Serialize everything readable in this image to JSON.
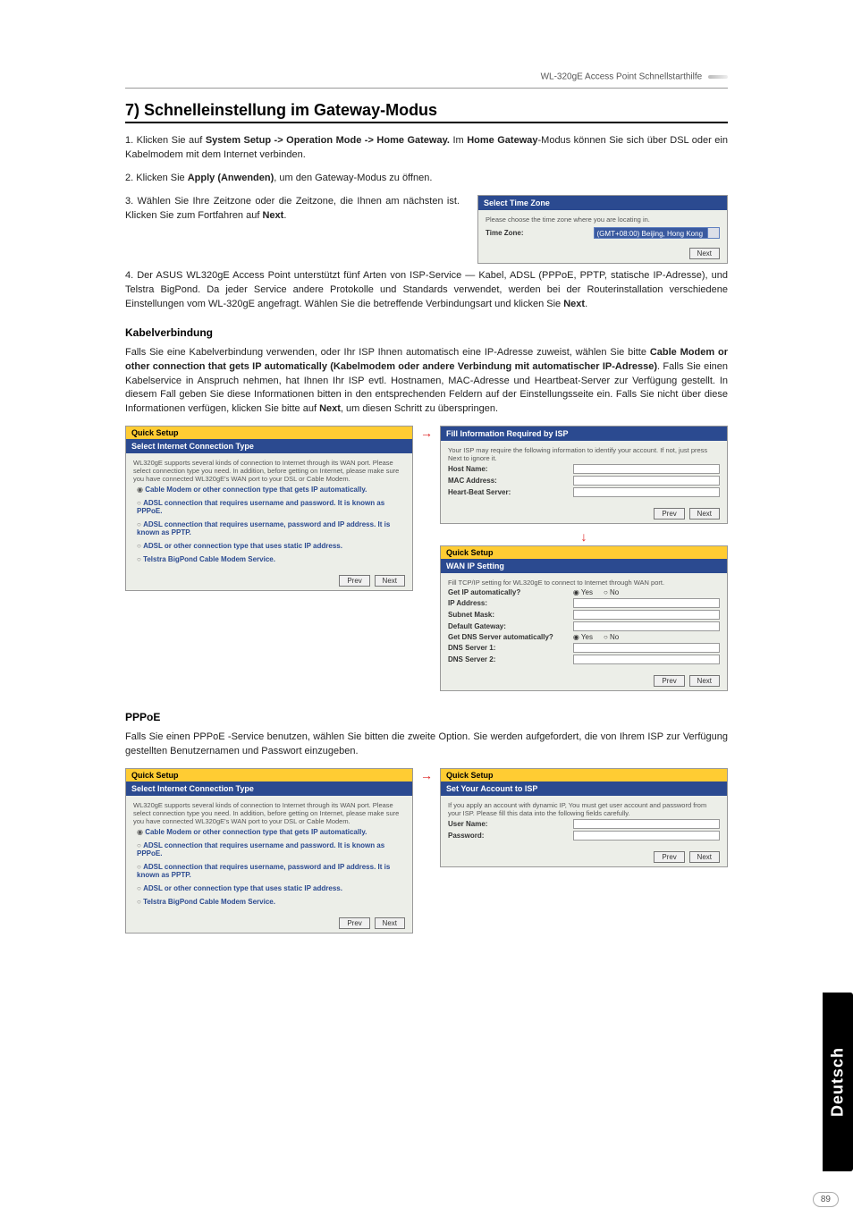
{
  "header": {
    "product": "WL-320gE Access Point Schnellstarthilfe"
  },
  "section": {
    "title": "7) Schnelleinstellung im Gateway-Modus",
    "step1_pre": "1. Klicken Sie auf ",
    "step1_bold1": "System Setup -> Operation Mode -> Home Gateway.",
    "step1_mid": " Im ",
    "step1_bold2": "Home Gateway",
    "step1_post": "-Modus können Sie sich über DSL oder ein Kabelmodem mit dem Internet verbinden.",
    "step2_pre": "2. Klicken Sie ",
    "step2_bold": "Apply (Anwenden)",
    "step2_post": ", um den Gateway-Modus zu öffnen.",
    "step3_pre": "3. Wählen Sie Ihre Zeitzone oder die Zeitzone, die Ihnen am nächsten ist. Klicken Sie zum Fortfahren auf ",
    "step3_bold": "Next",
    "step3_post": ".",
    "step4_pre": "4. Der ASUS WL320gE Access Point unterstützt fünf Arten von ISP-Service — Kabel, ADSL (PPPoE, PPTP, statische IP-Adresse), und Telstra BigPond. Da jeder Service andere Protokolle und Standards verwendet, werden bei der Routerinstallation verschiedene Einstellungen vom WL-320gE angefragt. Wählen Sie die betreffende Verbindungsart und klicken Sie ",
    "step4_bold": "Next",
    "step4_post": "."
  },
  "tz_panel": {
    "hdr": "Select Time Zone",
    "note": "Please choose the time zone where you are locating in.",
    "label": "Time Zone:",
    "value": "(GMT+08:00) Beijing, Hong Kong",
    "btn_next": "Next"
  },
  "kabel": {
    "title": "Kabelverbindung",
    "para_pre": "Falls Sie eine Kabelverbindung verwenden, oder Ihr ISP Ihnen automatisch eine IP-Adresse zuweist, wählen Sie bitte ",
    "para_bold": "Cable Modem or other connection that gets IP automatically (Kabelmodem oder andere Verbindung mit automatischer IP-Adresse)",
    "para_mid": ". Falls Sie einen Kabelservice in Anspruch nehmen, hat Ihnen Ihr ISP evtl. Hostnamen, MAC-Adresse und Heartbeat-Server zur Verfügung gestellt. In diesem Fall geben Sie diese Informationen bitten in den entsprechenden Feldern auf der Einstellungsseite ein. Falls Sie nicht über diese Informationen verfügen, klicken Sie bitte auf ",
    "para_bold2": "Next",
    "para_post": ", um diesen Schritt zu überspringen."
  },
  "quick_left": {
    "yellow": "Quick Setup",
    "hdr": "Select Internet Connection Type",
    "desc": "WL320gE supports several kinds of connection to Internet through its WAN port. Please select connection type you need. In addition, before getting on Internet, please make sure you have connected WL320gE's WAN port to your DSL or Cable Modem.",
    "opt1": "Cable Modem or other connection type that gets IP automatically.",
    "opt2": "ADSL connection that requires username and password. It is known as PPPoE.",
    "opt3": "ADSL connection that requires username, password and IP address. It is known as PPTP.",
    "opt4": "ADSL or other connection type that uses static IP address.",
    "opt5": "Telstra BigPond Cable Modem Service.",
    "btn_prev": "Prev",
    "btn_next": "Next"
  },
  "quick_r1": {
    "hdr": "Fill Information Required by ISP",
    "note": "Your ISP may require the following information to identify your account. If not, just press Next to ignore it.",
    "host": "Host Name:",
    "mac": "MAC Address:",
    "hb": "Heart-Beat Server:",
    "btn_prev": "Prev",
    "btn_next": "Next"
  },
  "quick_r2": {
    "yellow": "Quick Setup",
    "hdr": "WAN IP Setting",
    "note": "Fill TCP/IP setting for WL320gE to connect to Internet through WAN port.",
    "getip": "Get IP automatically?",
    "ip": "IP Address:",
    "mask": "Subnet Mask:",
    "gw": "Default Gateway:",
    "getdns": "Get DNS Server automatically?",
    "dns1": "DNS Server 1:",
    "dns2": "DNS Server 2:",
    "yes": "Yes",
    "no": "No",
    "btn_prev": "Prev",
    "btn_next": "Next"
  },
  "pppoe": {
    "title": "PPPoE",
    "para": "Falls Sie einen PPPoE -Service benutzen, wählen Sie bitten die zweite Option. Sie werden aufgefordert, die von Ihrem ISP zur Verfügung gestellten Benutzernamen und Passwort einzugeben."
  },
  "pppoe_left": {
    "yellow": "Quick Setup",
    "hdr": "Select Internet Connection Type",
    "desc": "WL320gE supports several kinds of connection to Internet through its WAN port. Please select connection type you need. In addition, before getting on Internet, please make sure you have connected WL320gE's WAN port to your DSL or Cable Modem.",
    "opt1": "Cable Modem or other connection type that gets IP automatically.",
    "opt2": "ADSL connection that requires username and password. It is known as PPPoE.",
    "opt3": "ADSL connection that requires username, password and IP address. It is known as PPTP.",
    "opt4": "ADSL or other connection type that uses static IP address.",
    "opt5": "Telstra BigPond Cable Modem Service.",
    "btn_prev": "Prev",
    "btn_next": "Next"
  },
  "pppoe_right": {
    "yellow": "Quick Setup",
    "hdr": "Set Your Account to ISP",
    "note": "If you apply an account with dynamic IP, You must get user account and password from your ISP. Please fill this data into the following fields carefully.",
    "user": "User Name:",
    "pass": "Password:",
    "btn_prev": "Prev",
    "btn_next": "Next"
  },
  "side": {
    "lang": "Deutsch",
    "page": "89"
  }
}
